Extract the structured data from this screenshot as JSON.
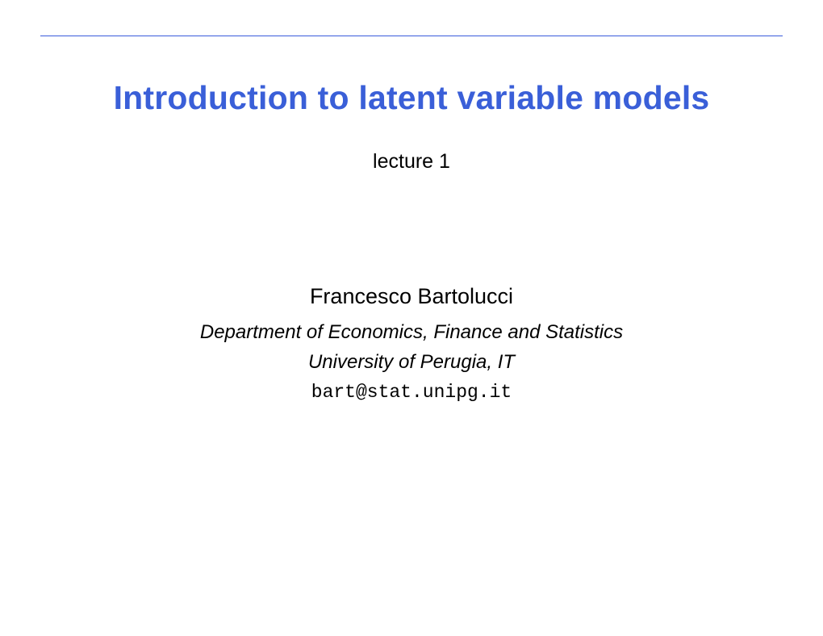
{
  "title": "Introduction to latent variable models",
  "subtitle": "lecture 1",
  "author": {
    "name": "Francesco Bartolucci",
    "department": "Department of Economics, Finance and Statistics",
    "university": "University of Perugia, IT",
    "email": "bart@stat.unipg.it"
  }
}
